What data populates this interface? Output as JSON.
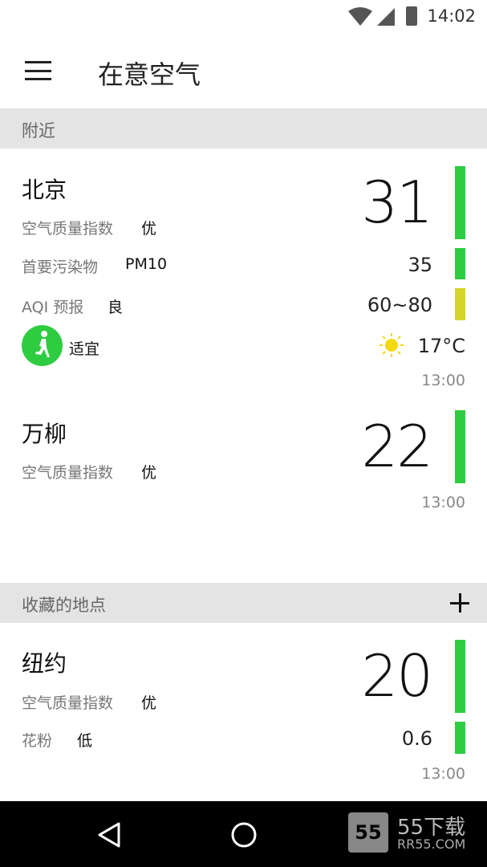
{
  "status": {
    "time": "14:02"
  },
  "app": {
    "title": "在意空气"
  },
  "colors": {
    "good": "#2ecc40",
    "moderate": "#d4d42a",
    "accent": "#2ecc40"
  },
  "nearby": {
    "header": "附近",
    "locations": [
      {
        "city": "北京",
        "aqi_label": "空气质量指数",
        "aqi_level": "优",
        "aqi": "31",
        "pollutant_label": "首要污染物",
        "pollutant": "PM10",
        "pollutant_value": "35",
        "forecast_label": "AQI 预报",
        "forecast_level": "良",
        "forecast_value": "60~80",
        "activity": "适宜",
        "activity_icon": "running-icon",
        "weather_icon": "sun-icon",
        "temperature": "17°C",
        "time": "13:00"
      },
      {
        "city": "万柳",
        "aqi_label": "空气质量指数",
        "aqi_level": "优",
        "aqi": "22",
        "time": "13:00"
      }
    ]
  },
  "favorites": {
    "header": "收藏的地点",
    "add_icon": "plus-icon",
    "locations": [
      {
        "city": "纽约",
        "aqi_label": "空气质量指数",
        "aqi_level": "优",
        "aqi": "20",
        "pollen_label": "花粉",
        "pollen_level": "低",
        "pollen_value": "0.6",
        "time": "13:00"
      }
    ]
  },
  "watermark": {
    "logo": "55",
    "text": "55下载",
    "sub": "RR55.COM"
  }
}
